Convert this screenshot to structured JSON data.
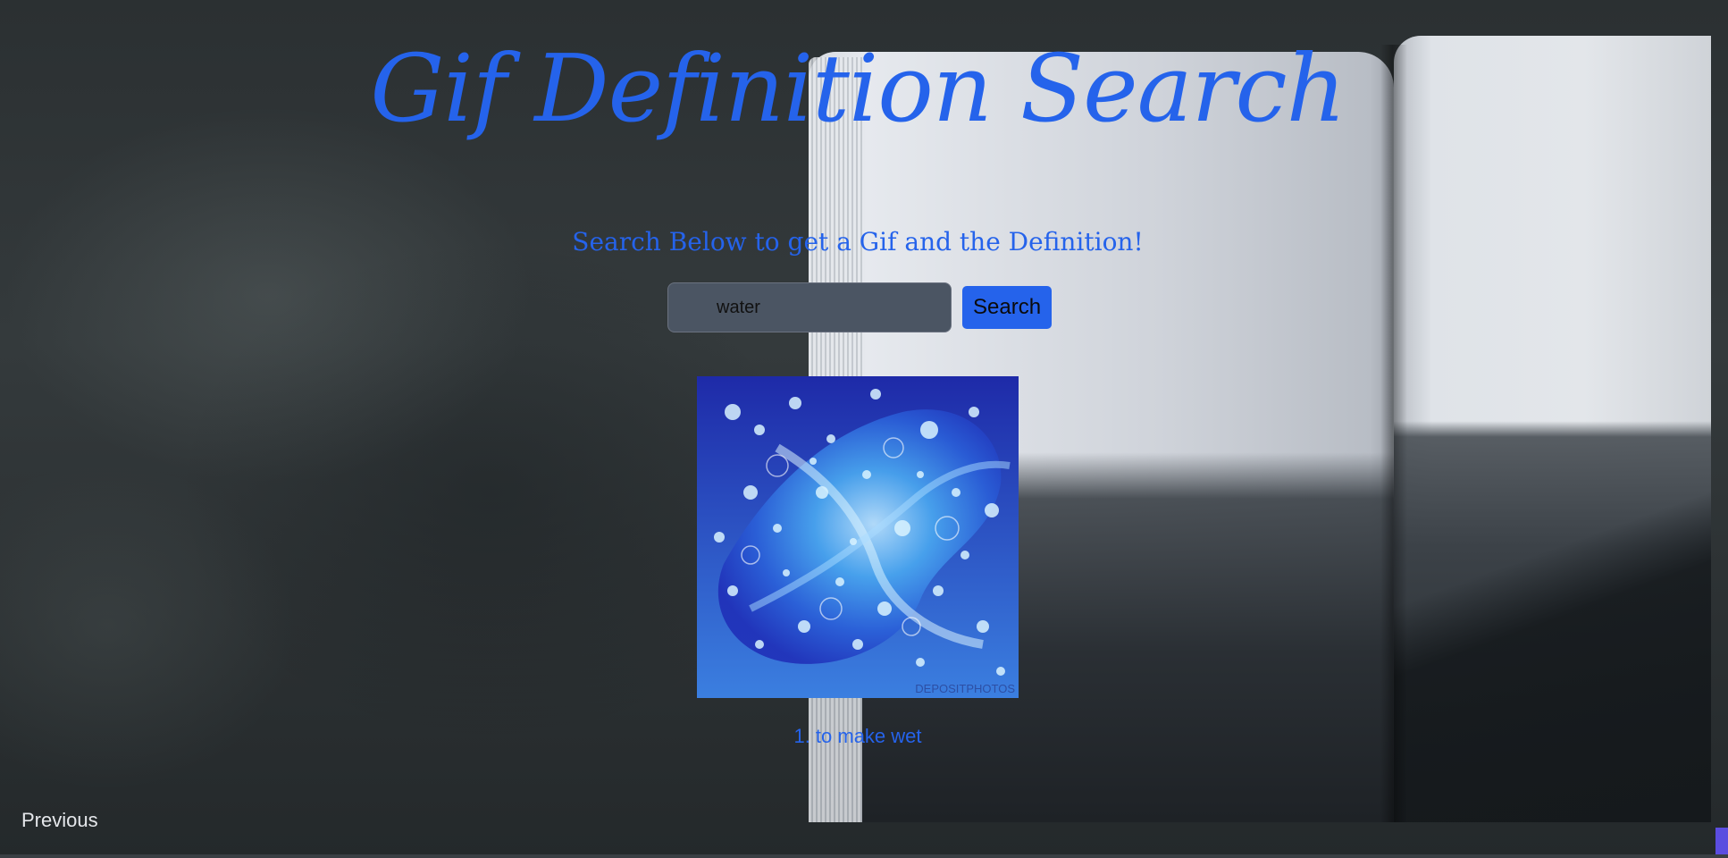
{
  "header": {
    "title": "Gif Definition Search",
    "subtitle": "Search Below to get a Gif and the Definition!"
  },
  "search": {
    "value": "water",
    "button_label": "Search"
  },
  "result": {
    "gif_watermark": "DEPOSITPHOTOS",
    "definition": "1. to make wet"
  },
  "nav": {
    "previous_label": "Previous"
  },
  "colors": {
    "accent": "#2563eb",
    "input_bg": "#4b5563",
    "background": "#2f3436"
  },
  "icons": {
    "background_image": "open-book-on-slate",
    "gif_image": "water-splash-bubbles"
  }
}
